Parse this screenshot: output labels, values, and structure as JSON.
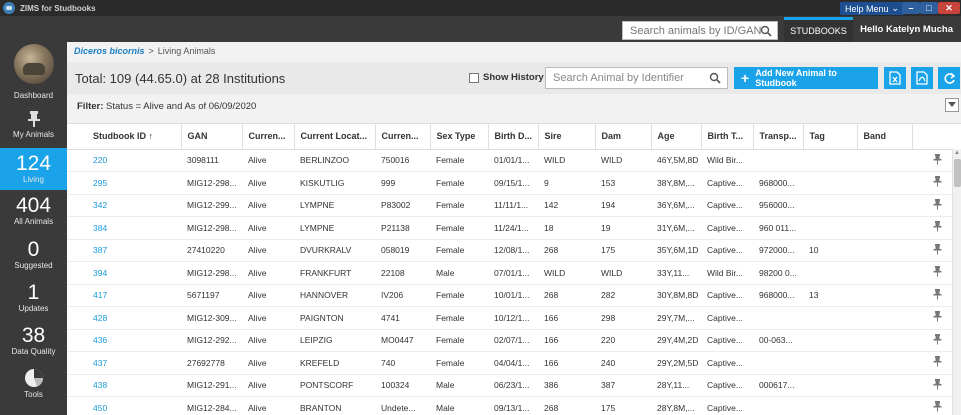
{
  "titlebar": {
    "title": "ZIMS for Studbooks",
    "help_menu": "Help Menu"
  },
  "appbar": {
    "search_placeholder": "Search animals by ID/GAN",
    "studbooks_label": "STUDBOOKS",
    "greeting": "Hello Katelyn Mucha"
  },
  "sidebar": {
    "dashboard": "Dashboard",
    "my_animals": "My Animals",
    "living_count": "124",
    "living": "Living",
    "all_count": "404",
    "all_animals": "All Animals",
    "suggested_count": "0",
    "suggested": "Suggested",
    "updates_count": "1",
    "updates": "Updates",
    "dq_count": "38",
    "data_quality": "Data Quality",
    "tools": "Tools"
  },
  "breadcrumb": {
    "species": "Diceros bicornis",
    "sep": ">",
    "page": "Living Animals"
  },
  "toolbar": {
    "total": "Total: 109 (44.65.0) at 28 Institutions",
    "show_history": "Show History",
    "search_placeholder": "Search Animal by Identifier",
    "add_label": "Add New Animal to Studbook"
  },
  "filter": {
    "label": "Filter:",
    "text": "Status = Alive and As of 06/09/2020"
  },
  "table": {
    "headers": [
      "Studbook ID ↑",
      "GAN",
      "Curren...",
      "Current Locat...",
      "Curren...",
      "Sex Type",
      "Birth D...",
      "Sire",
      "Dam",
      "Age",
      "Birth T...",
      "Transp...",
      "Tag",
      "Band",
      ""
    ],
    "rows": [
      [
        "220",
        "3098111",
        "Alive",
        "BERLINZOO",
        "750016",
        "Female",
        "01/01/1...",
        "WILD",
        "WILD",
        "46Y,5M,8D",
        "Wild Bir...",
        "",
        "",
        ""
      ],
      [
        "295",
        "MIG12-298...",
        "Alive",
        "KISKUTLIG",
        "999",
        "Female",
        "09/15/1...",
        "9",
        "153",
        "38Y,8M,...",
        "Captive...",
        "968000...",
        "",
        ""
      ],
      [
        "342",
        "MIG12-299...",
        "Alive",
        "LYMPNE",
        "P83002",
        "Female",
        "11/11/1...",
        "142",
        "194",
        "36Y,6M,...",
        "Captive...",
        "956000...",
        "",
        ""
      ],
      [
        "384",
        "MIG12-298...",
        "Alive",
        "LYMPNE",
        "P21138",
        "Female",
        "11/24/1...",
        "18",
        "19",
        "31Y,6M,...",
        "Captive...",
        "960 011...",
        "",
        ""
      ],
      [
        "387",
        "27410220",
        "Alive",
        "DVURKRALV",
        "058019",
        "Female",
        "12/08/1...",
        "268",
        "175",
        "35Y,6M,1D",
        "Captive...",
        "972000...",
        "10",
        ""
      ],
      [
        "394",
        "MIG12-298...",
        "Alive",
        "FRANKFURT",
        "22108",
        "Male",
        "07/01/1...",
        "WILD",
        "WILD",
        "33Y,11...",
        "Wild Bir...",
        "98200 0...",
        "",
        ""
      ],
      [
        "417",
        "5671197",
        "Alive",
        "HANNOVER",
        "IV206",
        "Female",
        "10/01/1...",
        "268",
        "282",
        "30Y,8M,8D",
        "Captive...",
        "968000...",
        "13",
        ""
      ],
      [
        "428",
        "MIG12-309...",
        "Alive",
        "PAIGNTON",
        "4741",
        "Female",
        "10/12/1...",
        "166",
        "298",
        "29Y,7M,...",
        "Captive...",
        "",
        "",
        ""
      ],
      [
        "436",
        "MIG12-292...",
        "Alive",
        "LEIPZIG",
        "MO0447",
        "Female",
        "02/07/1...",
        "166",
        "220",
        "29Y,4M,2D",
        "Captive...",
        "00-063...",
        "",
        ""
      ],
      [
        "437",
        "27692778",
        "Alive",
        "KREFELD",
        "740",
        "Female",
        "04/04/1...",
        "166",
        "240",
        "29Y,2M,5D",
        "Captive...",
        "",
        "",
        ""
      ],
      [
        "438",
        "MIG12-291...",
        "Alive",
        "PONTSCORF",
        "100324",
        "Male",
        "06/23/1...",
        "386",
        "387",
        "28Y,11...",
        "Captive...",
        "000617...",
        "",
        ""
      ],
      [
        "450",
        "MIG12-284...",
        "Alive",
        "BRANTON",
        "Undete...",
        "Male",
        "09/13/1...",
        "268",
        "175",
        "28Y,8M,...",
        "Captive...",
        "",
        "",
        ""
      ]
    ]
  }
}
